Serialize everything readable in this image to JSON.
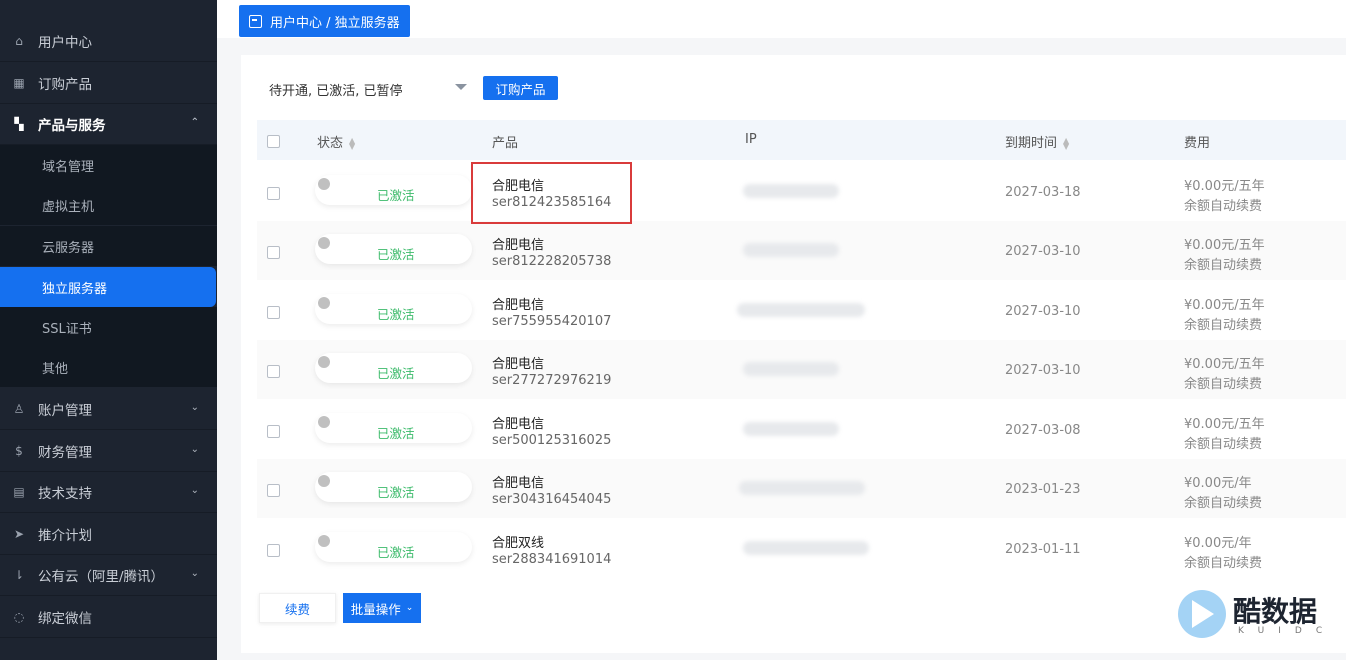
{
  "sidebar": {
    "items": [
      {
        "label": "用户中心",
        "icon": "home-icon"
      },
      {
        "label": "订购产品",
        "icon": "grid-icon"
      },
      {
        "label": "产品与服务",
        "icon": "apps-icon"
      },
      {
        "label": "账户管理",
        "icon": "user-icon"
      },
      {
        "label": "财务管理",
        "icon": "dollar-icon"
      },
      {
        "label": "技术支持",
        "icon": "ticket-icon"
      },
      {
        "label": "推介计划",
        "icon": "send-icon"
      },
      {
        "label": "公有云（阿里/腾讯）",
        "icon": "sort-icon"
      },
      {
        "label": "绑定微信",
        "icon": "chat-icon"
      }
    ],
    "subitems": [
      {
        "label": "域名管理"
      },
      {
        "label": "虚拟主机"
      },
      {
        "label": "云服务器"
      },
      {
        "label": "独立服务器"
      },
      {
        "label": "SSL证书"
      },
      {
        "label": "其他"
      }
    ]
  },
  "breadcrumb": "用户中心 / 独立服务器",
  "filter": {
    "value": "待开通, 已激活, 已暂停"
  },
  "order_button": "订购产品",
  "table": {
    "headers": {
      "status": "状态",
      "product": "产品",
      "ip": "IP",
      "expiry": "到期时间",
      "fee": "费用"
    },
    "rows": [
      {
        "status": "已激活",
        "product": "合肥电信",
        "id": "ser812423585164",
        "date": "2027-03-18",
        "fee": "¥0.00元/五年",
        "renew": "余额自动续费"
      },
      {
        "status": "已激活",
        "product": "合肥电信",
        "id": "ser812228205738",
        "date": "2027-03-10",
        "fee": "¥0.00元/五年",
        "renew": "余额自动续费"
      },
      {
        "status": "已激活",
        "product": "合肥电信",
        "id": "ser755955420107",
        "date": "2027-03-10",
        "fee": "¥0.00元/五年",
        "renew": "余额自动续费"
      },
      {
        "status": "已激活",
        "product": "合肥电信",
        "id": "ser277272976219",
        "date": "2027-03-10",
        "fee": "¥0.00元/五年",
        "renew": "余额自动续费"
      },
      {
        "status": "已激活",
        "product": "合肥电信",
        "id": "ser500125316025",
        "date": "2027-03-08",
        "fee": "¥0.00元/五年",
        "renew": "余额自动续费"
      },
      {
        "status": "已激活",
        "product": "合肥电信",
        "id": "ser304316454045",
        "date": "2023-01-23",
        "fee": "¥0.00元/年",
        "renew": "余额自动续费"
      },
      {
        "status": "已激活",
        "product": "合肥双线",
        "id": "ser288341691014",
        "date": "2023-01-11",
        "fee": "¥0.00元/年",
        "renew": "余额自动续费"
      }
    ]
  },
  "actions": {
    "renew": "续费",
    "batch": "批量操作"
  },
  "watermark": {
    "text": "酷数据",
    "sub": "KUIDC"
  },
  "colors": {
    "primary": "#1570ef",
    "sidebar_bg": "#1d2430",
    "status_green": "#3dbb6b",
    "highlight_red": "#d93b3b"
  }
}
